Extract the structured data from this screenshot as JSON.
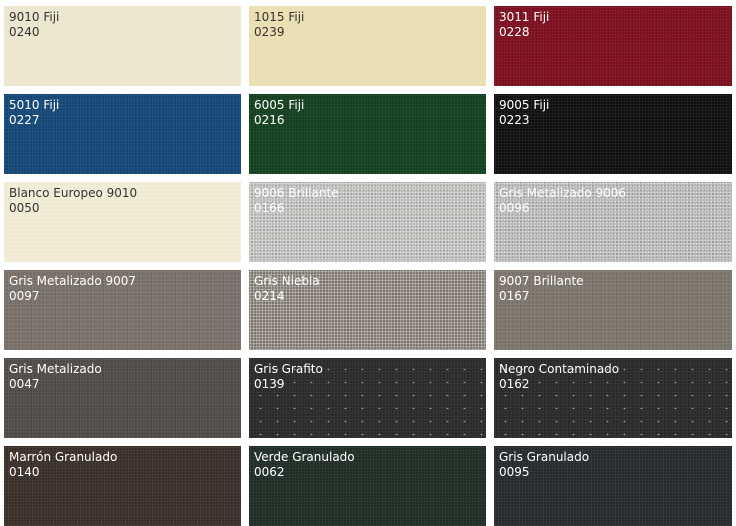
{
  "swatches": [
    {
      "name": "9010 Fiji",
      "code": "0240",
      "color": "#efe8d1",
      "text": "dark",
      "finish": "smooth"
    },
    {
      "name": "1015 Fiji",
      "code": "0239",
      "color": "#ece0b5",
      "text": "dark",
      "finish": "smooth"
    },
    {
      "name": "3011 Fiji",
      "code": "0228",
      "color": "#7e0c1c",
      "text": "light",
      "finish": "grain"
    },
    {
      "name": "5010 Fiji",
      "code": "0227",
      "color": "#124677",
      "text": "light",
      "finish": "grain"
    },
    {
      "name": "6005 Fiji",
      "code": "0216",
      "color": "#123f1d",
      "text": "light",
      "finish": "grain"
    },
    {
      "name": "9005 Fiji",
      "code": "0223",
      "color": "#0e0e11",
      "text": "light",
      "finish": "grain"
    },
    {
      "name": "Blanco Europeo 9010",
      "code": "0050",
      "color": "#f3ecd7",
      "text": "dark",
      "finish": "smooth"
    },
    {
      "name": "9006 Brillante",
      "code": "0166",
      "color": "#b8b9b6",
      "text": "light",
      "finish": "metallic"
    },
    {
      "name": "Gris Metalizado 9006",
      "code": "0096",
      "color": "#b1b2b0",
      "text": "light",
      "finish": "metallic"
    },
    {
      "name": "Gris Metalizado 9007",
      "code": "0097",
      "color": "#7a716b",
      "text": "light",
      "finish": "grain"
    },
    {
      "name": "Gris Niebla",
      "code": "0214",
      "color": "#7d756c",
      "text": "light",
      "finish": "metallic"
    },
    {
      "name": "9007 Brillante",
      "code": "0167",
      "color": "#7d766d",
      "text": "light",
      "finish": "grain"
    },
    {
      "name": "Gris Metalizado",
      "code": "0047",
      "color": "#4f4b46",
      "text": "light",
      "finish": "grain"
    },
    {
      "name": "Gris Grafito",
      "code": "0139",
      "color": "#2c2a2c",
      "text": "light",
      "finish": "sparkle"
    },
    {
      "name": "Negro Contaminado",
      "code": "0162",
      "color": "#2c292b",
      "text": "light",
      "finish": "sparkle"
    },
    {
      "name": "Marrón Granulado",
      "code": "0140",
      "color": "#3a2d27",
      "text": "light",
      "finish": "grain"
    },
    {
      "name": "Verde Granulado",
      "code": "0062",
      "color": "#1d2c24",
      "text": "light",
      "finish": "grain"
    },
    {
      "name": "Gris Granulado",
      "code": "0095",
      "color": "#25292b",
      "text": "light",
      "finish": "grain"
    }
  ]
}
